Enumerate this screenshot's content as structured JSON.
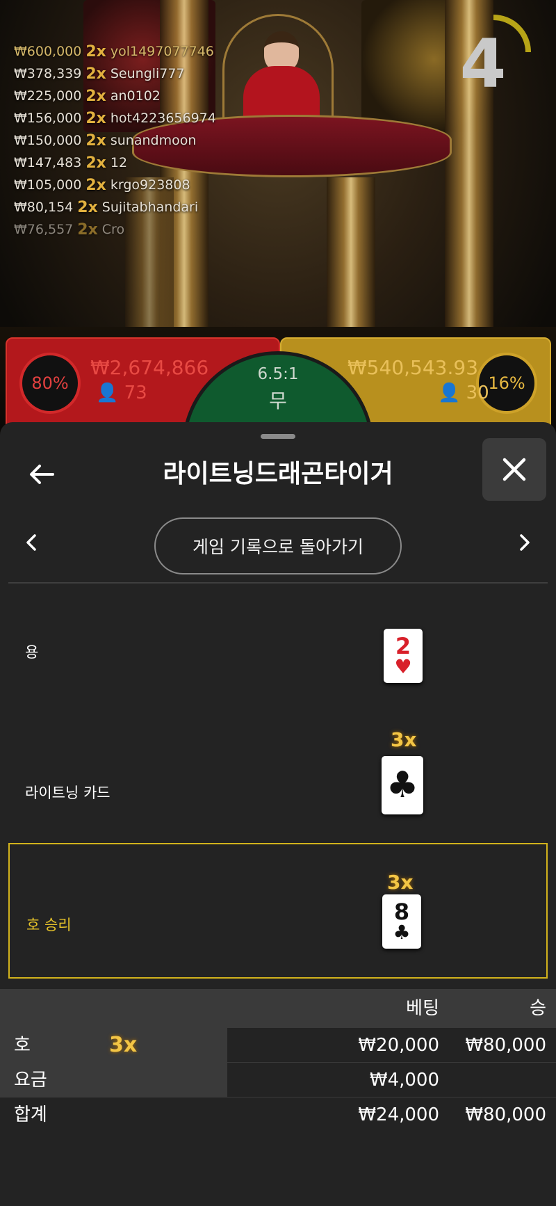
{
  "stream": {
    "countdown": "4",
    "winners": [
      {
        "amount": "₩600,000",
        "multiplier": "2x",
        "name": "yol1497077746"
      },
      {
        "amount": "₩378,339",
        "multiplier": "2x",
        "name": "Seungli777"
      },
      {
        "amount": "₩225,000",
        "multiplier": "2x",
        "name": "an0102"
      },
      {
        "amount": "₩156,000",
        "multiplier": "2x",
        "name": "hot4223656974"
      },
      {
        "amount": "₩150,000",
        "multiplier": "2x",
        "name": "sunandmoon"
      },
      {
        "amount": "₩147,483",
        "multiplier": "2x",
        "name": "12"
      },
      {
        "amount": "₩105,000",
        "multiplier": "2x",
        "name": "krgo923808"
      },
      {
        "amount": "₩80,154",
        "multiplier": "2x",
        "name": "Sujitabhandari"
      },
      {
        "amount": "₩76,557",
        "multiplier": "2x",
        "name": "Cro"
      }
    ]
  },
  "board": {
    "dragon": {
      "percent": "80%",
      "total": "₩2,674,866",
      "players": "73"
    },
    "tiger": {
      "percent": "16%",
      "total": "₩540,543.93",
      "players": "30"
    },
    "tie": {
      "odds": "6.5:1",
      "label": "무"
    }
  },
  "sheet": {
    "title": "라이트닝드래곤타이거",
    "back_to_history": "게임 기록으로 돌아가기",
    "rows": {
      "dragon": {
        "label": "용",
        "card_rank": "2",
        "card_suit": "♥"
      },
      "lightning": {
        "label": "라이트닝 카드",
        "multiplier": "3x",
        "card_suit": "♣"
      },
      "tiger": {
        "label": "호 승리",
        "multiplier": "3x",
        "card_rank": "8",
        "card_suit": "♣"
      }
    }
  },
  "summary": {
    "header": {
      "bet": "베팅",
      "win": "승"
    },
    "rows": [
      {
        "label": "호",
        "multiplier": "3x",
        "bet": "₩20,000",
        "win": "₩80,000"
      },
      {
        "label": "요금",
        "bet": "₩4,000",
        "win": ""
      },
      {
        "label": "합계",
        "bet": "₩24,000",
        "win": "₩80,000"
      }
    ]
  },
  "colors": {
    "dragon": "#b3181c",
    "tiger": "#b8901e",
    "tie": "#0f5a2e",
    "highlight": "#d2b31c",
    "multiplier": "#f3c545"
  },
  "icons": [
    "back-arrow-icon",
    "close-icon",
    "chevron-left-icon",
    "chevron-right-icon",
    "person-icon"
  ]
}
